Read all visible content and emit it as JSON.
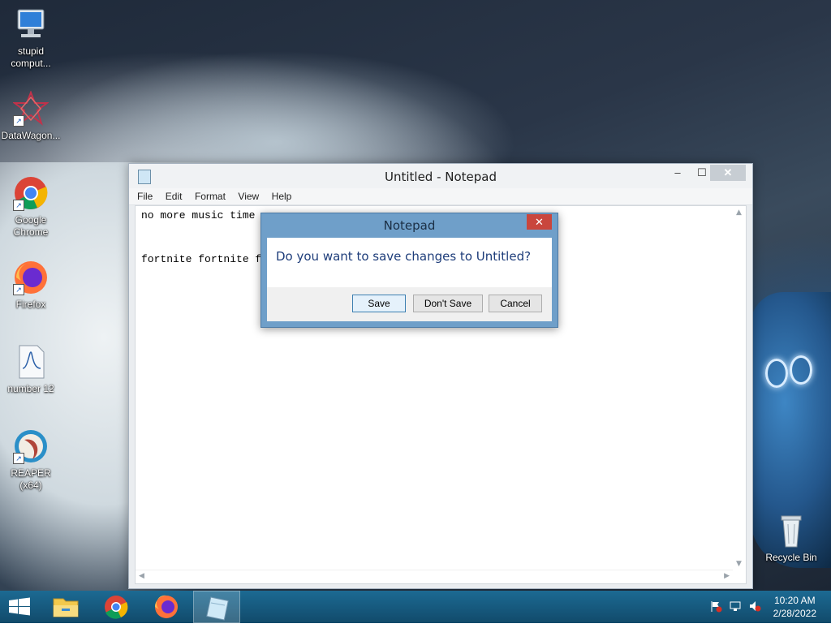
{
  "desktop": {
    "icons": [
      {
        "label": "stupid comput...",
        "icon": "computer-icon"
      },
      {
        "label": "DataWagon...",
        "icon": "datawagon-icon"
      },
      {
        "label": "Google Chrome",
        "icon": "chrome-icon"
      },
      {
        "label": "Firefox",
        "icon": "firefox-icon"
      },
      {
        "label": "number 12",
        "icon": "audio-file-icon"
      },
      {
        "label": "REAPER (x64)",
        "icon": "reaper-icon"
      },
      {
        "label": "Recycle Bin",
        "icon": "recycle-bin-icon"
      }
    ]
  },
  "notepad": {
    "title": "Untitled - Notepad",
    "menu": [
      "File",
      "Edit",
      "Format",
      "View",
      "Help"
    ],
    "lines": [
      "no more music time",
      "fortnite fortnite f"
    ],
    "controls": {
      "minimize": "‒",
      "maximize": "☐",
      "close": "✕"
    }
  },
  "dialog": {
    "title": "Notepad",
    "message": "Do you want to save changes to Untitled?",
    "buttons": {
      "save": "Save",
      "dont_save": "Don't Save",
      "cancel": "Cancel"
    },
    "close": "✕"
  },
  "taskbar": {
    "items": [
      "start-icon",
      "file-explorer-icon",
      "chrome-icon",
      "firefox-icon",
      "notepad-icon"
    ],
    "tray": [
      "action-center-flag-icon",
      "network-icon",
      "volume-muted-icon"
    ],
    "time": "10:20 AM",
    "date": "2/28/2022"
  },
  "colors": {
    "taskbar": "#15577a",
    "dialog_frame": "#6f9fc9",
    "close_red": "#c9463d"
  }
}
